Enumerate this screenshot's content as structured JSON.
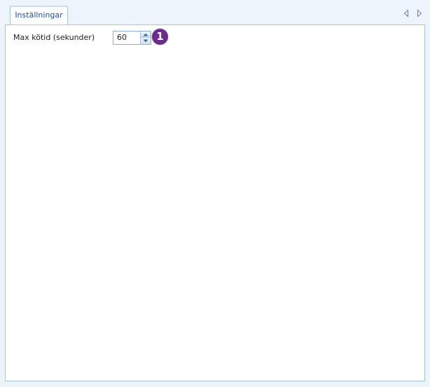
{
  "tabs": [
    {
      "label": "Inställningar",
      "active": true
    }
  ],
  "tab_navigation": {
    "prev_icon": "triangle-left-icon",
    "next_icon": "triangle-right-icon"
  },
  "settings": {
    "max_queue_time": {
      "label": "Max kötid (sekunder)",
      "value": "60"
    }
  },
  "callout": {
    "number": "1",
    "color": "#6b2c8c"
  },
  "colors": {
    "background": "#eef4fb",
    "panel_border": "#a6c3e0",
    "tab_text": "#1f4e96"
  }
}
